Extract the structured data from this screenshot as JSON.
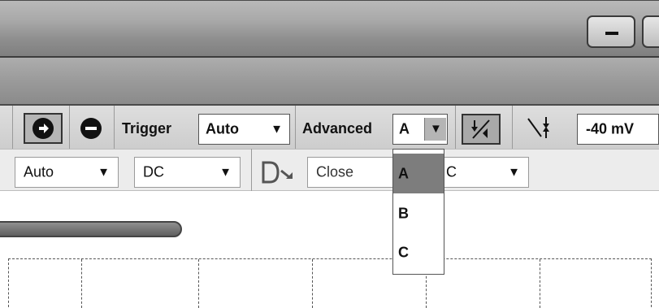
{
  "titlebar": {
    "minimize_icon": "minimize-icon"
  },
  "toolbar": {
    "run_icon": "arrow-right-circle-icon",
    "stop_icon": "minus-circle-icon",
    "trigger_label": "Trigger",
    "trigger_mode": "Auto",
    "advanced_label": "Advanced",
    "advanced_channel": "A",
    "edge_icon": "rising-edge-icon",
    "falling_icon": "falling-edge-icon",
    "threshold": "-40 mV"
  },
  "row2": {
    "auto_value": "Auto",
    "coupling_value": "DC",
    "delay_icon": "delay-arrow-icon",
    "close_placeholder": "Close",
    "range_value": "C"
  },
  "advanced_dropdown": {
    "options": [
      "A",
      "B",
      "C"
    ],
    "selected": "A"
  }
}
